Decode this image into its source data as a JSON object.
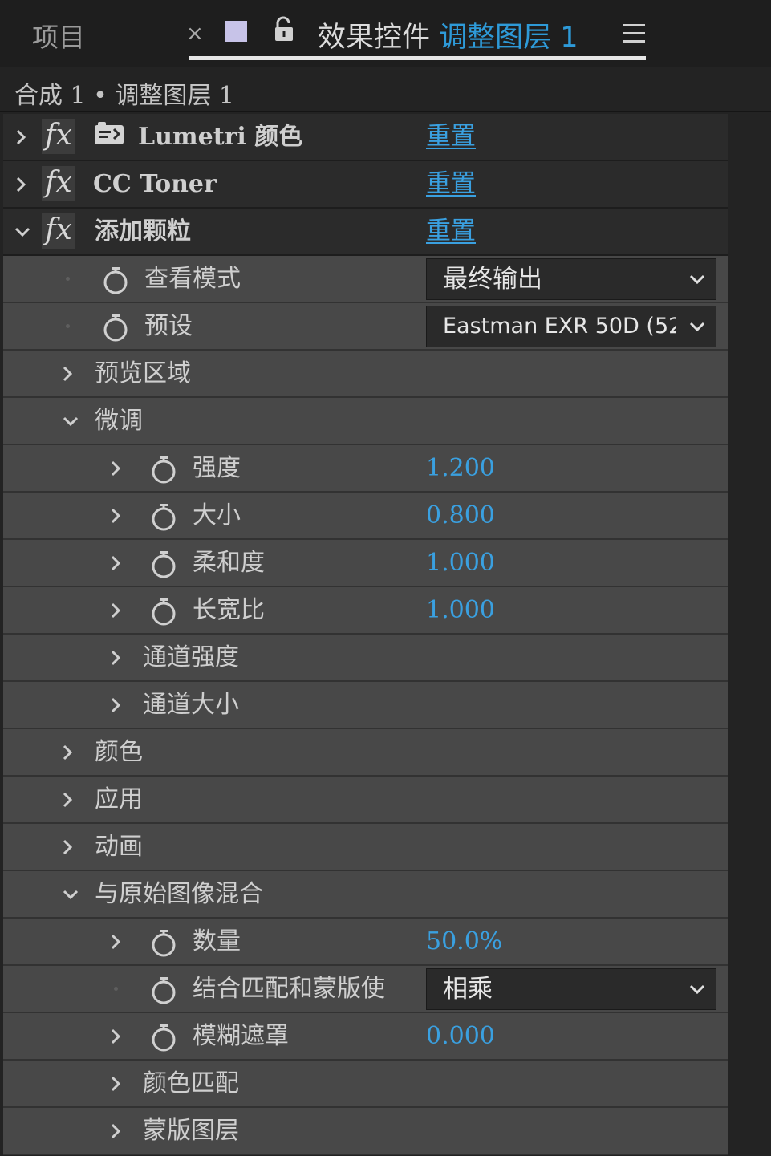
{
  "tabs": {
    "project_label": "项目",
    "close_glyph": "×",
    "effects_prefix": "效果控件",
    "effects_layer": "调整图层 1",
    "swatch_color": "#c7c3e8",
    "accent_color": "#2e9ad8"
  },
  "breadcrumb": {
    "text": "合成 1 • 调整图层 1"
  },
  "effects": [
    {
      "name": "Lumetri 颜色",
      "reset_label": "重置"
    },
    {
      "name": "CC Toner",
      "reset_label": "重置"
    },
    {
      "name": "添加颗粒",
      "reset_label": "重置"
    }
  ],
  "grain": {
    "view_mode_label": "查看模式",
    "view_mode_value": "最终输出",
    "preset_label": "预设",
    "preset_value": "Eastman EXR 50D (52",
    "preview_region_label": "预览区域",
    "tweak_label": "微调",
    "intensity_label": "强度",
    "intensity_value": "1.200",
    "size_label": "大小",
    "size_value": "0.800",
    "softness_label": "柔和度",
    "softness_value": "1.000",
    "aspect_label": "长宽比",
    "aspect_value": "1.000",
    "channel_intensity_label": "通道强度",
    "channel_size_label": "通道大小",
    "color_label": "颜色",
    "application_label": "应用",
    "animation_label": "动画",
    "blend_label": "与原始图像混合",
    "amount_label": "数量",
    "amount_value": "50.0%",
    "combine_label": "结合匹配和蒙版使",
    "combine_value": "相乘",
    "blur_matte_label": "模糊遮罩",
    "blur_matte_value": "0.000",
    "color_match_label": "颜色匹配",
    "matte_layer_label": "蒙版图层"
  }
}
